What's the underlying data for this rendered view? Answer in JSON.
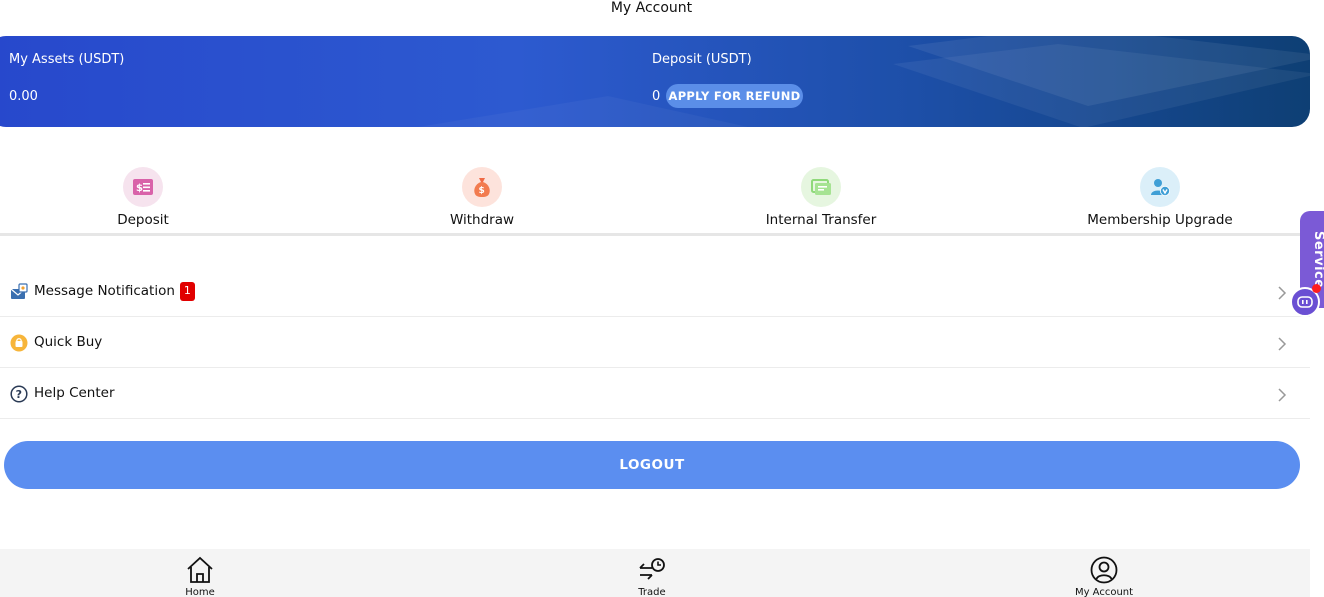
{
  "page": {
    "title": "My Account"
  },
  "assets": {
    "my_assets_label": "My Assets (USDT)",
    "my_assets_value": "0.00",
    "deposit_label": "Deposit (USDT)",
    "deposit_value": "0",
    "refund_button": "APPLY FOR REFUND"
  },
  "actions": [
    {
      "label": "Deposit",
      "icon": "deposit-icon",
      "color": "#e06bb0"
    },
    {
      "label": "Withdraw",
      "icon": "money-bag-icon",
      "color": "#f0704a"
    },
    {
      "label": "Internal Transfer",
      "icon": "transfer-icon",
      "color": "#7ed26a"
    },
    {
      "label": "Membership Upgrade",
      "icon": "member-icon",
      "color": "#3aa7d8"
    }
  ],
  "menu": [
    {
      "label": "Message Notification",
      "badge": "1",
      "icon": "mail-icon"
    },
    {
      "label": "Quick Buy",
      "icon": "quick-buy-icon"
    },
    {
      "label": "Help Center",
      "icon": "help-icon"
    }
  ],
  "logout_label": "LOGOUT",
  "service_label": "Service",
  "bottom_nav": [
    {
      "label": "Home",
      "icon": "home-icon"
    },
    {
      "label": "Trade",
      "icon": "trade-icon"
    },
    {
      "label": "My Account",
      "icon": "account-icon"
    }
  ],
  "colors": {
    "accent": "#5b8ef0",
    "card_start": "#2748cc",
    "card_end": "#0e3f74",
    "badge": "#e10000",
    "service": "#7b5ad6"
  }
}
